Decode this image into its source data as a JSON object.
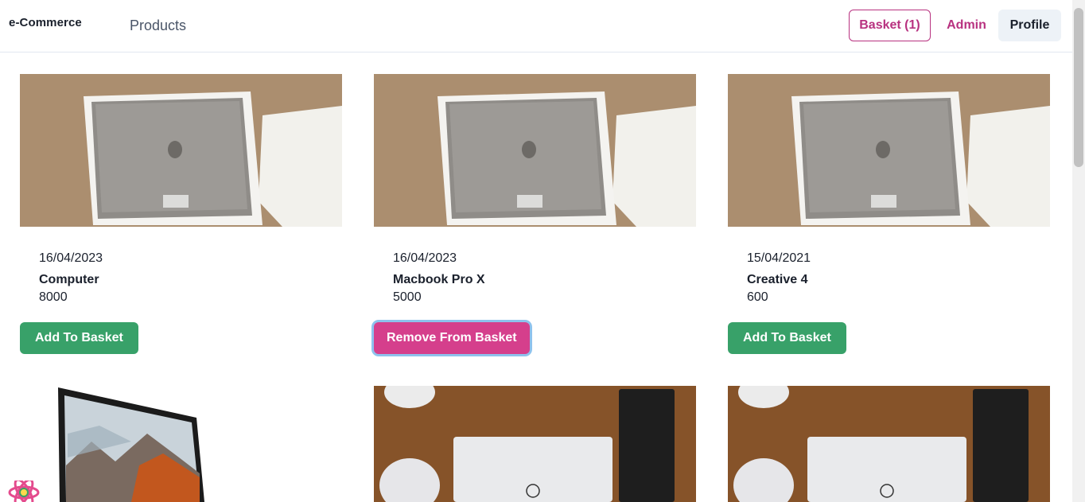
{
  "navbar": {
    "brand": "e-Commerce",
    "products_link": "Products",
    "basket_label": "Basket (1)",
    "admin_label": "Admin",
    "profile_label": "Profile"
  },
  "products": [
    {
      "date": "16/04/2023",
      "title": "Computer",
      "price": "8000",
      "action": "Add To Basket"
    },
    {
      "date": "16/04/2023",
      "title": "Macbook Pro X",
      "price": "5000",
      "action": "Remove From Basket"
    },
    {
      "date": "15/04/2021",
      "title": "Creative 4",
      "price": "600",
      "action": "Add To Basket"
    }
  ],
  "colors": {
    "accent_pink": "#b83280",
    "add_green": "#38a169",
    "remove_pink": "#d53f8c"
  }
}
